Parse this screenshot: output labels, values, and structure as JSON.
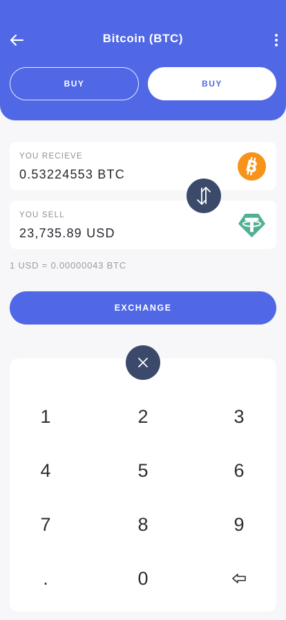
{
  "header": {
    "title": "Bitcoin (BTC)",
    "tabs": [
      {
        "label": "BUY",
        "active": false
      },
      {
        "label": "BUY",
        "active": true
      }
    ]
  },
  "receive": {
    "label": "YOU RECIEVE",
    "value": "0.53224553 BTC",
    "icon": "bitcoin-icon"
  },
  "sell": {
    "label": "YOU SELL",
    "value": "23,735.89 USD",
    "icon": "tether-icon"
  },
  "rate": "1 USD = 0.00000043 BTC",
  "exchange_label": "EXCHANGE",
  "keypad": {
    "keys": [
      "1",
      "2",
      "3",
      "4",
      "5",
      "6",
      "7",
      "8",
      "9",
      ".",
      "0"
    ]
  },
  "colors": {
    "primary": "#5067e6",
    "dark_button": "#3b4a6b",
    "bitcoin": "#f7931a",
    "tether": "#50af95"
  }
}
